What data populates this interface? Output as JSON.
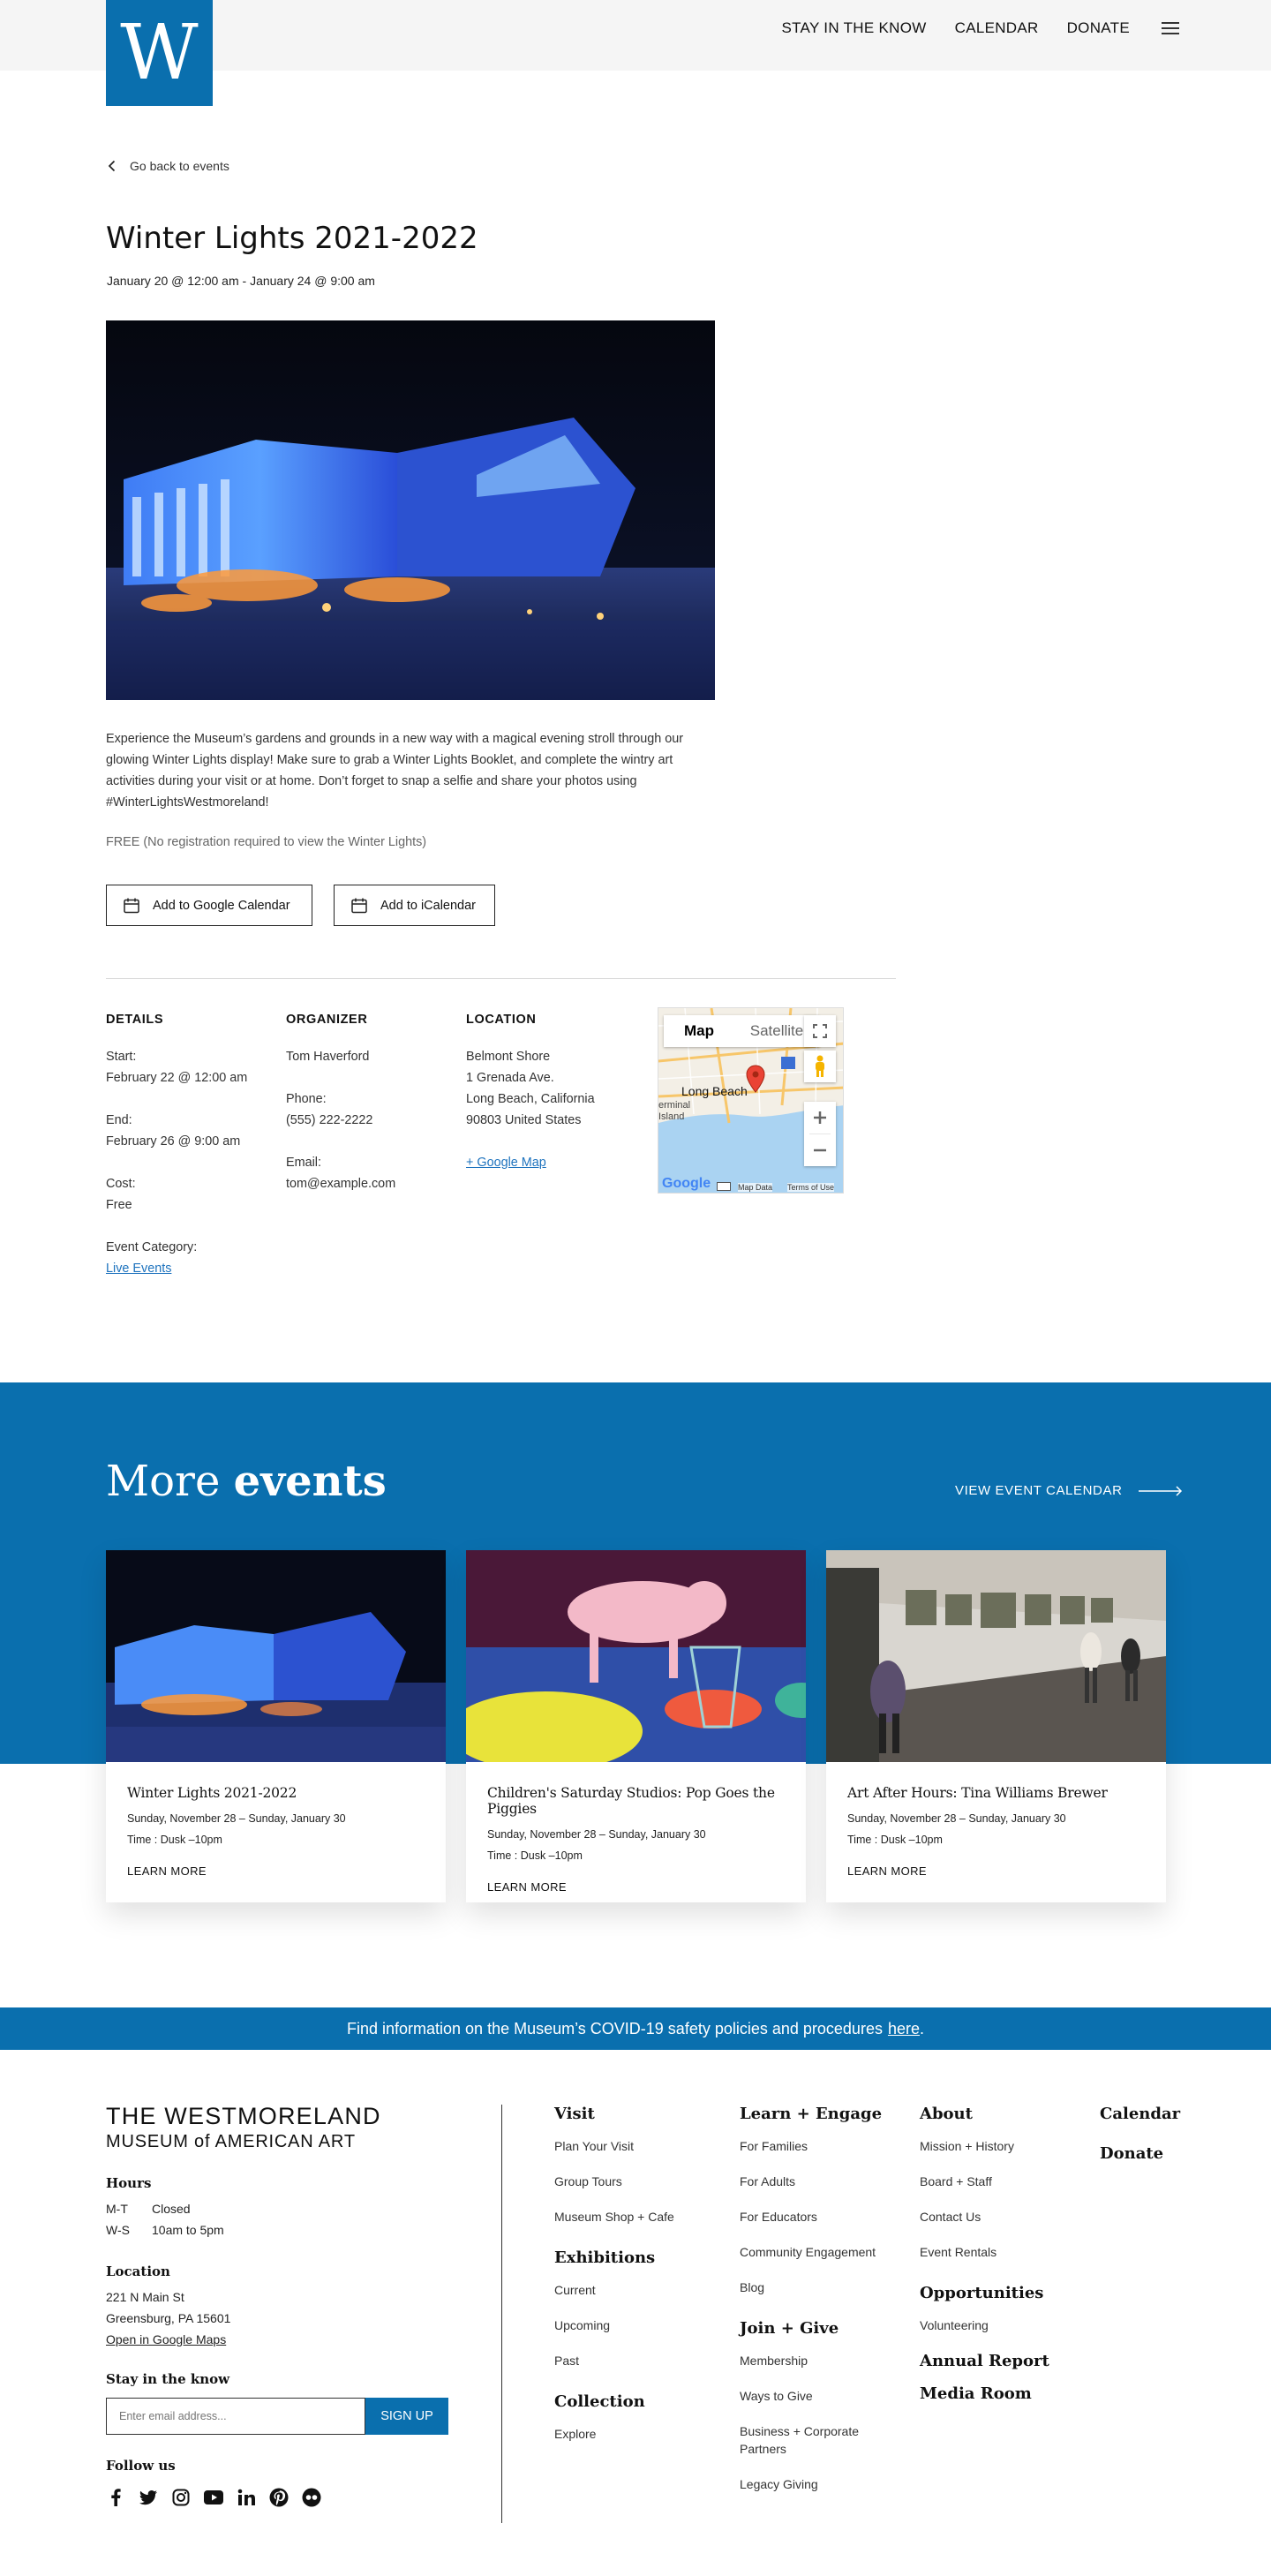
{
  "header": {
    "logo_letter": "W",
    "nav": [
      "STAY IN THE KNOW",
      "CALENDAR",
      "DONATE"
    ]
  },
  "event": {
    "back_label": "Go back to events",
    "title": "Winter Lights 2021-2022",
    "dates": "January 20 @ 12:00 am - January 24 @ 9:00 am",
    "description": "Experience the Museum’s gardens and grounds in a new way with a magical evening stroll through our glowing Winter Lights display! Make sure to grab a Winter Lights Booklet, and complete the wintry art activities during your visit or at home. Don’t forget to snap a selfie and share your photos using #WinterLightsWestmoreland!",
    "cost_note": "FREE (No registration required to view the Winter Lights)",
    "google_cal": "Add to Google Calendar",
    "ical": "Add to iCalendar"
  },
  "details": {
    "heading": "DETAILS",
    "start_label": "Start:",
    "start": "February 22 @ 12:00 am",
    "end_label": "End:",
    "end": "February 26 @ 9:00 am",
    "cost_label": "Cost:",
    "cost": "Free",
    "category_label": "Event Category:",
    "category": "Live Events"
  },
  "organizer": {
    "heading": "ORGANIZER",
    "name": "Tom Haverford",
    "phone_label": "Phone:",
    "phone": "(555) 222-2222",
    "email_label": "Email:",
    "email": "tom@example.com"
  },
  "location": {
    "heading": "LOCATION",
    "line1": "Belmont Shore",
    "line2": "1 Grenada Ave.",
    "line3": "Long Beach, California",
    "line4": "90803 United States",
    "map_link": "+ Google Map"
  },
  "map": {
    "tab_map": "Map",
    "tab_satellite": "Satellite",
    "place": "Long Beach",
    "place2": "erminal",
    "place3": "Island",
    "attrib": "Map Data",
    "terms": "Terms of Use",
    "google": "Google"
  },
  "more_events": {
    "title_light": "More",
    "title_bold": "events",
    "view_calendar": "VIEW EVENT CALENDAR",
    "cards": [
      {
        "title": "Winter Lights 2021-2022",
        "dates": "Sunday, November 28 – Sunday, January 30",
        "time": "Time : Dusk –10pm",
        "cta": "LEARN MORE"
      },
      {
        "title": "Children's Saturday Studios: Pop Goes the Piggies",
        "dates": "Sunday, November 28 – Sunday, January 30",
        "time": "Time : Dusk –10pm",
        "cta": "LEARN MORE"
      },
      {
        "title": "Art After Hours: Tina Williams Brewer",
        "dates": "Sunday, November 28 – Sunday, January 30",
        "time": "Time : Dusk –10pm",
        "cta": "LEARN MORE"
      }
    ]
  },
  "covid": {
    "text": "Find information on the Museum’s COVID-19 safety policies and procedures",
    "link": "here",
    "end": "."
  },
  "footer": {
    "brand_line1": "THE WESTMORELAND",
    "brand_line2": "MUSEUM of AMERICAN ART",
    "hours_heading": "Hours",
    "hours": [
      {
        "days": "M-T",
        "time": "Closed"
      },
      {
        "days": "W-S",
        "time": "10am to 5pm"
      }
    ],
    "location_heading": "Location",
    "address1": "221 N Main St",
    "address2": "Greensburg, PA 15601",
    "maps_link": "Open in Google Maps",
    "stay_heading": "Stay in the know",
    "email_placeholder": "Enter email address...",
    "signup": "SIGN UP",
    "follow_heading": "Follow us",
    "visit": {
      "heading": "Visit",
      "items": [
        "Plan Your Visit",
        "Group Tours",
        "Museum Shop + Cafe"
      ]
    },
    "exhibitions": {
      "heading": "Exhibitions",
      "items": [
        "Current",
        "Upcoming",
        "Past"
      ]
    },
    "collection": {
      "heading": "Collection",
      "items": [
        "Explore"
      ]
    },
    "learn": {
      "heading": "Learn + Engage",
      "items": [
        "For Families",
        "For Adults",
        "For Educators",
        "Community Engagement",
        "Blog"
      ]
    },
    "join": {
      "heading": "Join + Give",
      "items": [
        "Membership",
        "Ways to Give",
        "Business + Corporate Partners",
        "Legacy Giving"
      ]
    },
    "about": {
      "heading": "About",
      "items": [
        "Mission + History",
        "Board + Staff",
        "Contact Us",
        "Event Rentals"
      ]
    },
    "opportunities": {
      "heading": "Opportunities",
      "items": [
        "Volunteering"
      ]
    },
    "annual_report": "Annual Report",
    "media_room": "Media Room",
    "calendar": "Calendar",
    "donate": "Donate"
  },
  "colors": {
    "brand_blue": "#0a6fae",
    "link_blue": "#1e73be"
  }
}
